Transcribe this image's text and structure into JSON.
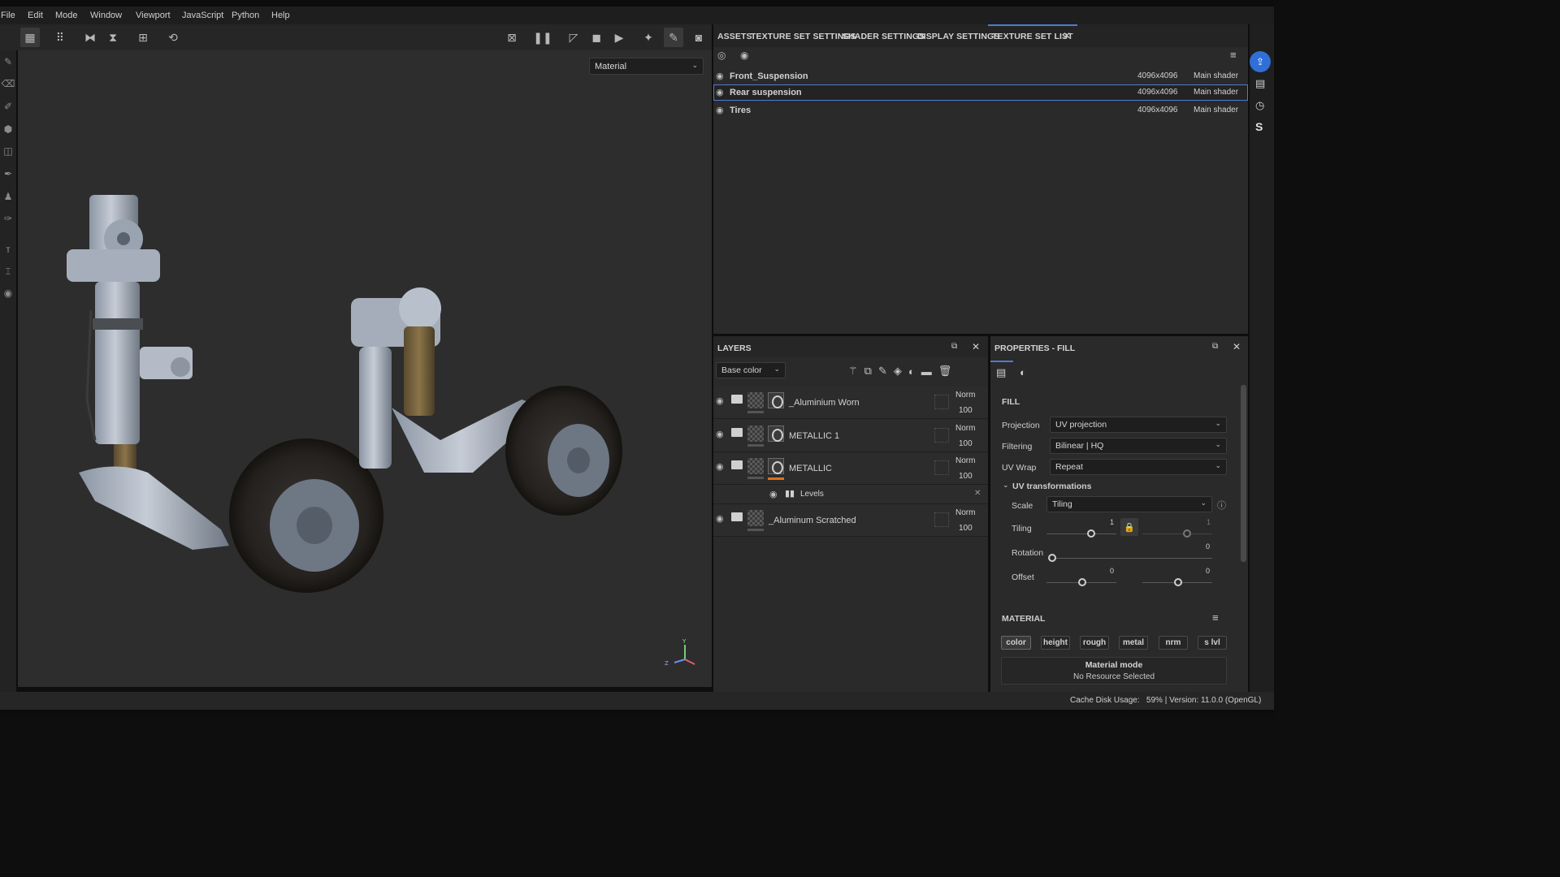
{
  "menu": [
    "File",
    "Edit",
    "Mode",
    "Window",
    "Viewport",
    "JavaScript",
    "Python",
    "Help"
  ],
  "viewport": {
    "material_select": "Material",
    "axis_y": "Y",
    "axis_z": "Z"
  },
  "tabs": [
    "ASSETS",
    "TEXTURE SET SETTINGS",
    "SHADER SETTINGS",
    "DISPLAY SETTINGS",
    "TEXTURE SET LIST"
  ],
  "texture_sets": [
    {
      "name": "Front_Suspension",
      "res": "4096x4096",
      "shader": "Main shader"
    },
    {
      "name": "Rear suspension",
      "res": "4096x4096",
      "shader": "Main shader"
    },
    {
      "name": "Tires",
      "res": "4096x4096",
      "shader": "Main shader"
    }
  ],
  "layers": {
    "title": "LAYERS",
    "channel": "Base color",
    "items": [
      {
        "name": "_Aluminium Worn",
        "blend": "Norm",
        "opacity": "100"
      },
      {
        "name": "METALLIC 1",
        "blend": "Norm",
        "opacity": "100"
      },
      {
        "name": "METALLIC",
        "blend": "Norm",
        "opacity": "100"
      },
      {
        "name": "_Aluminum Scratched",
        "blend": "Norm",
        "opacity": "100"
      }
    ],
    "sublayer": "Levels"
  },
  "properties": {
    "title": "PROPERTIES - FILL",
    "fill_header": "FILL",
    "projection_label": "Projection",
    "projection": "UV projection",
    "filtering_label": "Filtering",
    "filtering": "Bilinear | HQ",
    "uvwrap_label": "UV Wrap",
    "uvwrap": "Repeat",
    "uvt_header": "UV transformations",
    "scale_label": "Scale",
    "scale": "Tiling",
    "tiling_label": "Tiling",
    "tiling_value": "1",
    "tiling_value2": "1",
    "rotation_label": "Rotation",
    "rotation_value": "0",
    "offset_label": "Offset",
    "offset_x": "0",
    "offset_y": "0",
    "material_header": "MATERIAL",
    "chips": [
      "color",
      "height",
      "rough",
      "metal",
      "nrm",
      "s lvl"
    ],
    "material_mode": "Material mode",
    "no_resource": "No Resource Selected"
  },
  "status": "Cache Disk Usage:   59% | Version: 11.0.0 (OpenGL)",
  "colors": {
    "accent": "#2f6fd6",
    "orange": "#e0711f"
  }
}
